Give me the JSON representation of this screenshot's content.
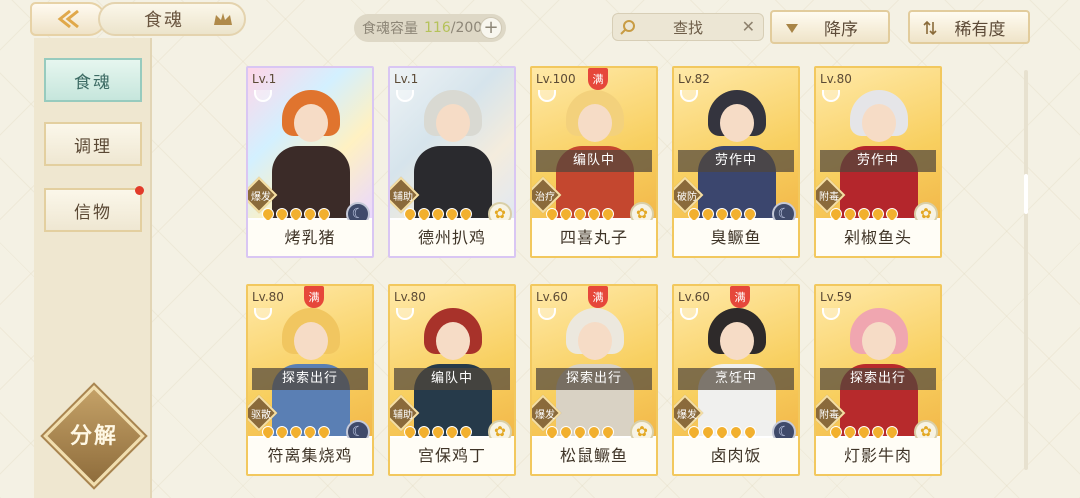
{
  "header": {
    "title": "食魂",
    "capacity_label": "食魂容量",
    "capacity_current": "116",
    "capacity_max": "/200",
    "capacity_add": "+",
    "search_label": "查找",
    "search_clear": "✕",
    "sort_order_label": "降序",
    "sort_by_label": "稀有度"
  },
  "sidebar": {
    "items": [
      {
        "label": "食魂",
        "active": true
      },
      {
        "label": "调理",
        "active": false
      },
      {
        "label": "信物",
        "active": false,
        "has_dot": true
      }
    ],
    "decompose_label": "分解"
  },
  "cards": [
    {
      "level": "Lv.1",
      "name": "烤乳猪",
      "status": "",
      "role": "爆发",
      "full": false,
      "frame": "rainbow",
      "element": "dark",
      "hair": "#e0742e",
      "body": "#3b2b28"
    },
    {
      "level": "Lv.1",
      "name": "德州扒鸡",
      "status": "",
      "role": "辅助",
      "full": false,
      "frame": "rainbow-silver",
      "element": "light",
      "hair": "#d9d9d2",
      "body": "#2a2a2e"
    },
    {
      "level": "Lv.100",
      "name": "四喜丸子",
      "status": "编队中",
      "role": "治疗",
      "full": true,
      "frame": "gold",
      "element": "light",
      "hair": "#f3d17c",
      "body": "#c4472f"
    },
    {
      "level": "Lv.82",
      "name": "臭鳜鱼",
      "status": "劳作中",
      "role": "破防",
      "full": false,
      "frame": "gold",
      "element": "dark",
      "hair": "#34343e",
      "body": "#3b466e"
    },
    {
      "level": "Lv.80",
      "name": "剁椒鱼头",
      "status": "劳作中",
      "role": "附毒",
      "full": false,
      "frame": "gold",
      "element": "light",
      "hair": "#e5e5e8",
      "body": "#b4262c"
    },
    {
      "level": "Lv.80",
      "name": "符离集烧鸡",
      "status": "探索出行",
      "role": "驱散",
      "full": true,
      "frame": "gold",
      "element": "dark",
      "hair": "#f1c660",
      "body": "#5a7fb4"
    },
    {
      "level": "Lv.80",
      "name": "宫保鸡丁",
      "status": "编队中",
      "role": "辅助",
      "full": false,
      "frame": "gold",
      "element": "light",
      "hair": "#a8322a",
      "body": "#263a4a"
    },
    {
      "level": "Lv.60",
      "name": "松鼠鳜鱼",
      "status": "探索出行",
      "role": "爆发",
      "full": true,
      "frame": "gold",
      "element": "light",
      "hair": "#ece8de",
      "body": "#d9d2c4"
    },
    {
      "level": "Lv.60",
      "name": "卤肉饭",
      "status": "烹饪中",
      "role": "爆发",
      "full": true,
      "frame": "gold",
      "element": "dark",
      "hair": "#2e2a2a",
      "body": "#f0f0ee"
    },
    {
      "level": "Lv.59",
      "name": "灯影牛肉",
      "status": "探索出行",
      "role": "附毒",
      "full": false,
      "frame": "gold",
      "element": "light",
      "hair": "#f0a6b0",
      "body": "#b72a2c"
    }
  ],
  "colors": {
    "accent_gold": "#f2c85e",
    "active_tab": "#c6e6dc",
    "capacity_highlight": "#b5c25a",
    "badge_red": "#e6473a"
  },
  "icons": {
    "back": "back-arrow-icon",
    "crown": "crown-icon",
    "search": "magnifier-icon",
    "sort_desc": "triangle-down-icon",
    "sort_rarity": "sort-arrows-icon",
    "element_light": "flower-icon",
    "element_dark": "moon-icon",
    "bowl": "bowl-icon"
  }
}
